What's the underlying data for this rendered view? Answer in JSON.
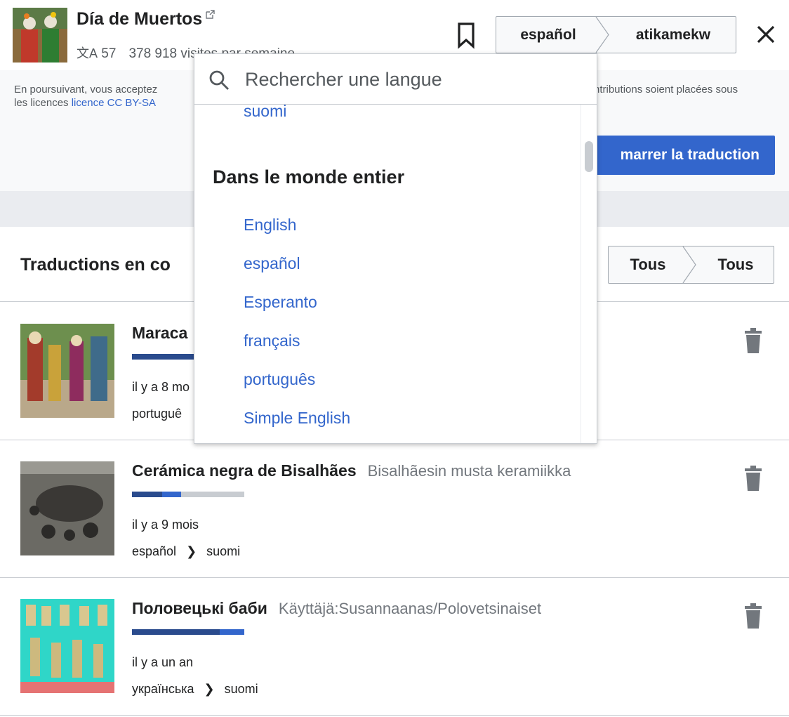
{
  "article": {
    "title": "Día de Muertos",
    "lang_count": "57",
    "visits": "378 918 visites par semaine"
  },
  "language_selector": {
    "source": "español",
    "target": "atikamekw"
  },
  "notice": {
    "text_before": "En poursuivant, vous acceptez",
    "text_after": "ntributions soient placées sous",
    "line2_before": "les licences",
    "license_link": "licence CC BY-SA"
  },
  "start_button": {
    "label": "marrer la traduction"
  },
  "translations": {
    "title": "Traductions en co",
    "filter_source": "Tous",
    "filter_target": "Tous",
    "items": [
      {
        "source_title": "Maraca",
        "target_title": "",
        "time": "il y a 8 mo",
        "source_lang": "portuguê",
        "target_lang": "",
        "progress_primary": 0.55,
        "progress_secondary": 0
      },
      {
        "source_title": "Cerámica negra de Bisalhães",
        "target_title": "Bisalhãesin musta keramiikka",
        "time": "il y a 9 mois",
        "source_lang": "español",
        "target_lang": "suomi",
        "progress_primary": 0.27,
        "progress_secondary": 0.17
      },
      {
        "source_title": "Половецькі баби",
        "target_title": "Käyttäjä:Susannaanas/Polovetsinaiset",
        "time": "il y a un an",
        "source_lang": "українська",
        "target_lang": "suomi",
        "progress_primary": 0.78,
        "progress_secondary": 0.22
      }
    ]
  },
  "dropdown": {
    "search_placeholder": "Rechercher une langue",
    "top_item": "suomi",
    "section_heading": "Dans le monde entier",
    "languages": [
      "English",
      "español",
      "Esperanto",
      "français",
      "português",
      "Simple English"
    ]
  },
  "colors": {
    "link": "#3366cc",
    "progress_dark": "#2a4b8d",
    "progress_blue": "#3366cc",
    "progress_track": "#c8ccd1"
  }
}
